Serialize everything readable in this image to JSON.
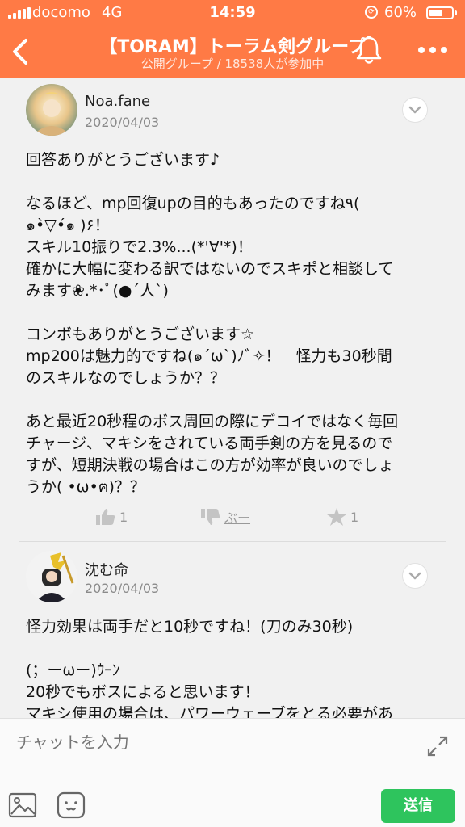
{
  "status_bar": {
    "carrier": "docomo",
    "network": "4G",
    "time": "14:59",
    "battery_percent": "60%",
    "battery_level": 0.6
  },
  "header": {
    "title": "【TORAM】トーラム剣グループ",
    "subtitle": "公開グループ / 18538人が参加中"
  },
  "posts": [
    {
      "author": "Noa.fane",
      "date": "2020/04/03",
      "body": "回答ありがとうございます♪\n\nなるほど、mp回復upの目的もあったのですね٩( \n๑•̀▽•́๑ )۶！\nスキル10振りで2.3%...(*'∀'*)！\n確かに大幅に変わる訳ではないのでスキポと相談して\nみます❀.*･ﾟ(●´人`)\n\nコンボもありがとうございます☆\nmp200は魅力的ですね(๑´ω`)ﾉﾞ✧！　怪力も30秒間\nのスキルなのでしょうか？？\n\nあと最近20秒程のボス周回の際にデコイではなく毎回\nチャージ、マキシをされている両手剣の方を見るので\nすが、短期決戦の場合はこの方が効率が良いのでしょ\nうか( •ω•ฅ)？？",
      "likes": "1",
      "dislike_label": "ぶー",
      "stars": "1"
    },
    {
      "author": "沈む命",
      "date": "2020/04/03",
      "body": "怪力効果は両手だと10秒ですね！(刀のみ30秒)\n\n(；ーωー)ｳｰﾝ\n20秒でもボスによると思います！\nマキシ使用の場合は、パワーウェーブをとる必要があ"
    }
  ],
  "composer": {
    "placeholder": "チャットを入力",
    "send_label": "送信"
  }
}
